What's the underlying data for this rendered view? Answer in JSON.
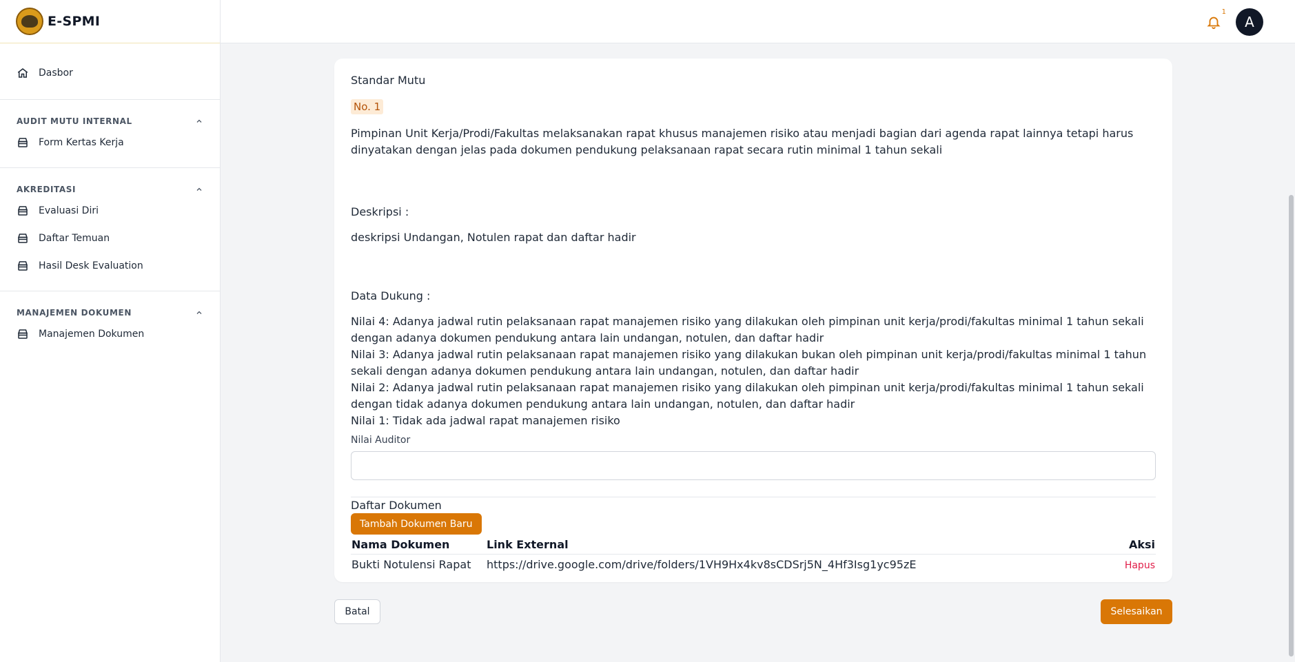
{
  "app": {
    "name": "E-SPMI"
  },
  "sidebar": {
    "home": {
      "label": "Dasbor"
    },
    "sections": [
      {
        "title": "AUDIT MUTU INTERNAL",
        "items": [
          {
            "label": "Form Kertas Kerja"
          }
        ]
      },
      {
        "title": "AKREDITASI",
        "items": [
          {
            "label": "Evaluasi Diri"
          },
          {
            "label": "Daftar Temuan"
          },
          {
            "label": "Hasil Desk Evaluation"
          }
        ]
      },
      {
        "title": "MANAJEMEN DOKUMEN",
        "items": [
          {
            "label": "Manajemen Dokumen"
          }
        ]
      }
    ]
  },
  "topbar": {
    "notification_count": "1",
    "avatar_initial": "A"
  },
  "main": {
    "standar_title": "Standar Mutu",
    "standar_no": "No. 1",
    "standar_text": "Pimpinan Unit Kerja/Prodi/Fakultas melaksanakan rapat khusus manajemen risiko atau menjadi bagian dari agenda rapat lainnya tetapi harus dinyatakan dengan jelas pada dokumen pendukung pelaksanaan rapat secara rutin minimal 1 tahun sekali",
    "deskripsi_label": "Deskripsi :",
    "deskripsi_text": "deskripsi Undangan, Notulen rapat dan daftar hadir",
    "data_dukung_label": "Data Dukung :",
    "data_dukung": [
      "Nilai 4: Adanya jadwal rutin pelaksanaan rapat manajemen risiko yang dilakukan oleh pimpinan unit kerja/prodi/fakultas minimal 1 tahun sekali dengan adanya dokumen pendukung antara lain undangan, notulen, dan daftar hadir",
      "Nilai 3: Adanya jadwal rutin pelaksanaan rapat manajemen risiko yang dilakukan bukan oleh pimpinan unit kerja/prodi/fakultas minimal 1 tahun sekali dengan adanya dokumen pendukung antara lain undangan, notulen, dan daftar hadir",
      "Nilai 2: Adanya jadwal rutin pelaksanaan rapat manajemen risiko yang dilakukan oleh pimpinan unit kerja/prodi/fakultas minimal 1 tahun sekali dengan tidak adanya dokumen pendukung antara lain undangan, notulen, dan daftar hadir",
      "Nilai 1: Tidak ada jadwal rapat manajemen risiko"
    ],
    "nilai_auditor_label": "Nilai Auditor",
    "nilai_auditor_value": "",
    "daftar_dokumen_title": "Daftar Dokumen",
    "add_button": "Tambah Dokumen Baru",
    "table": {
      "headers": {
        "name": "Nama Dokumen",
        "link": "Link External",
        "action": "Aksi"
      },
      "rows": [
        {
          "name": "Bukti Notulensi Rapat",
          "link": "https://drive.google.com/drive/folders/1VH9Hx4kv8sCDSrj5N_4Hf3Isg1yc95zE",
          "action": "Hapus"
        }
      ]
    }
  },
  "footer": {
    "cancel": "Batal",
    "finish": "Selesaikan"
  },
  "colors": {
    "accent": "#d97706",
    "danger": "#e11d48",
    "badge_bg": "#fdebd6"
  }
}
